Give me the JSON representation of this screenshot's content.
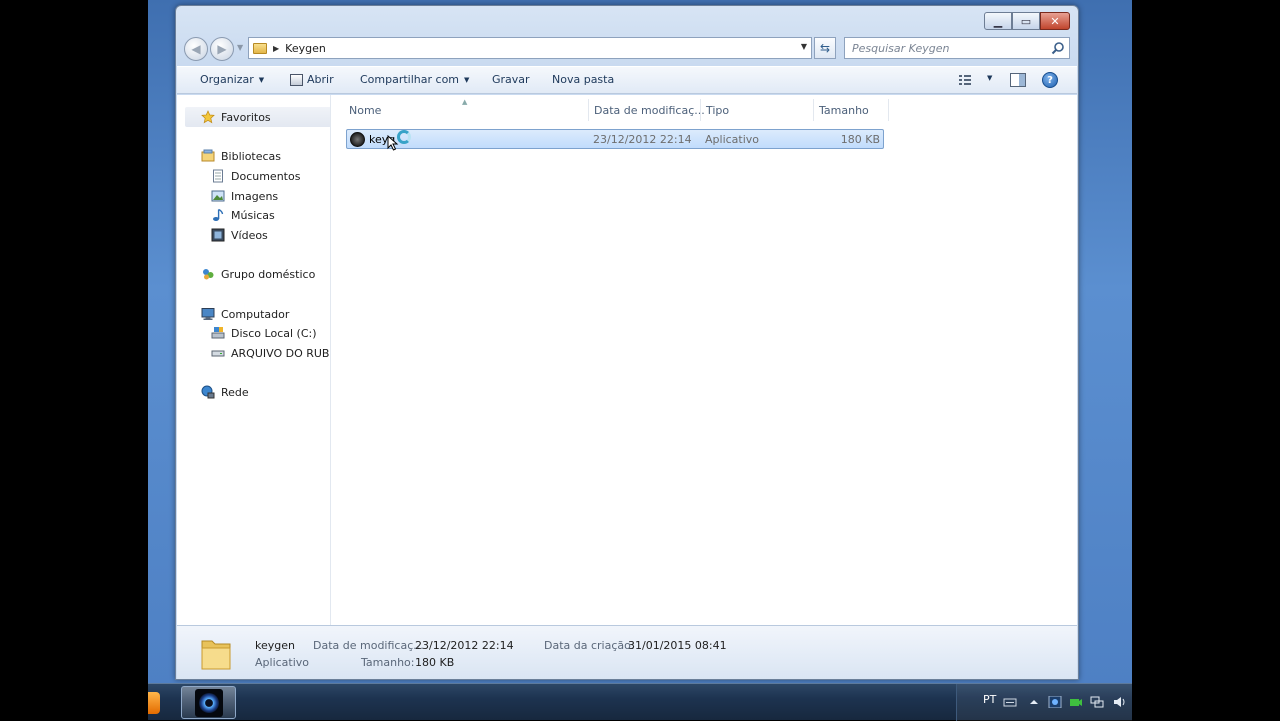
{
  "window": {
    "title_buttons": [
      "minimize-icon",
      "maximize-icon",
      "close-icon"
    ]
  },
  "address": {
    "path": "Keygen",
    "search_placeholder": "Pesquisar Keygen"
  },
  "toolbar": {
    "organize": "Organizar",
    "open": "Abrir",
    "share": "Compartilhar com",
    "burn": "Gravar",
    "new_folder": "Nova pasta"
  },
  "navpane": {
    "favorites": "Favoritos",
    "libraries": "Bibliotecas",
    "documents": "Documentos",
    "images": "Imagens",
    "music": "Músicas",
    "videos": "Vídeos",
    "homegroup": "Grupo doméstico",
    "computer": "Computador",
    "local_disk": "Disco Local (C:)",
    "drive2": "ARQUIVO DO RUBEN",
    "network": "Rede"
  },
  "columns": {
    "name": "Nome",
    "modified": "Data de modificaç...",
    "type": "Tipo",
    "size": "Tamanho"
  },
  "files": [
    {
      "name": "keyg",
      "modified": "23/12/2012 22:14",
      "type": "Aplicativo",
      "size": "180 KB",
      "selected": true
    }
  ],
  "details": {
    "name": "keygen",
    "type": "Aplicativo",
    "modified_label": "Data de modificaç...",
    "modified_value": "23/12/2012 22:14",
    "size_label": "Tamanho:",
    "size_value": "180 KB",
    "created_label": "Data da criação:",
    "created_value": "31/01/2015 08:41"
  },
  "taskbar": {
    "language": "PT"
  },
  "colors": {
    "selection": "#c1dcfc",
    "accent": "#1e395b"
  }
}
